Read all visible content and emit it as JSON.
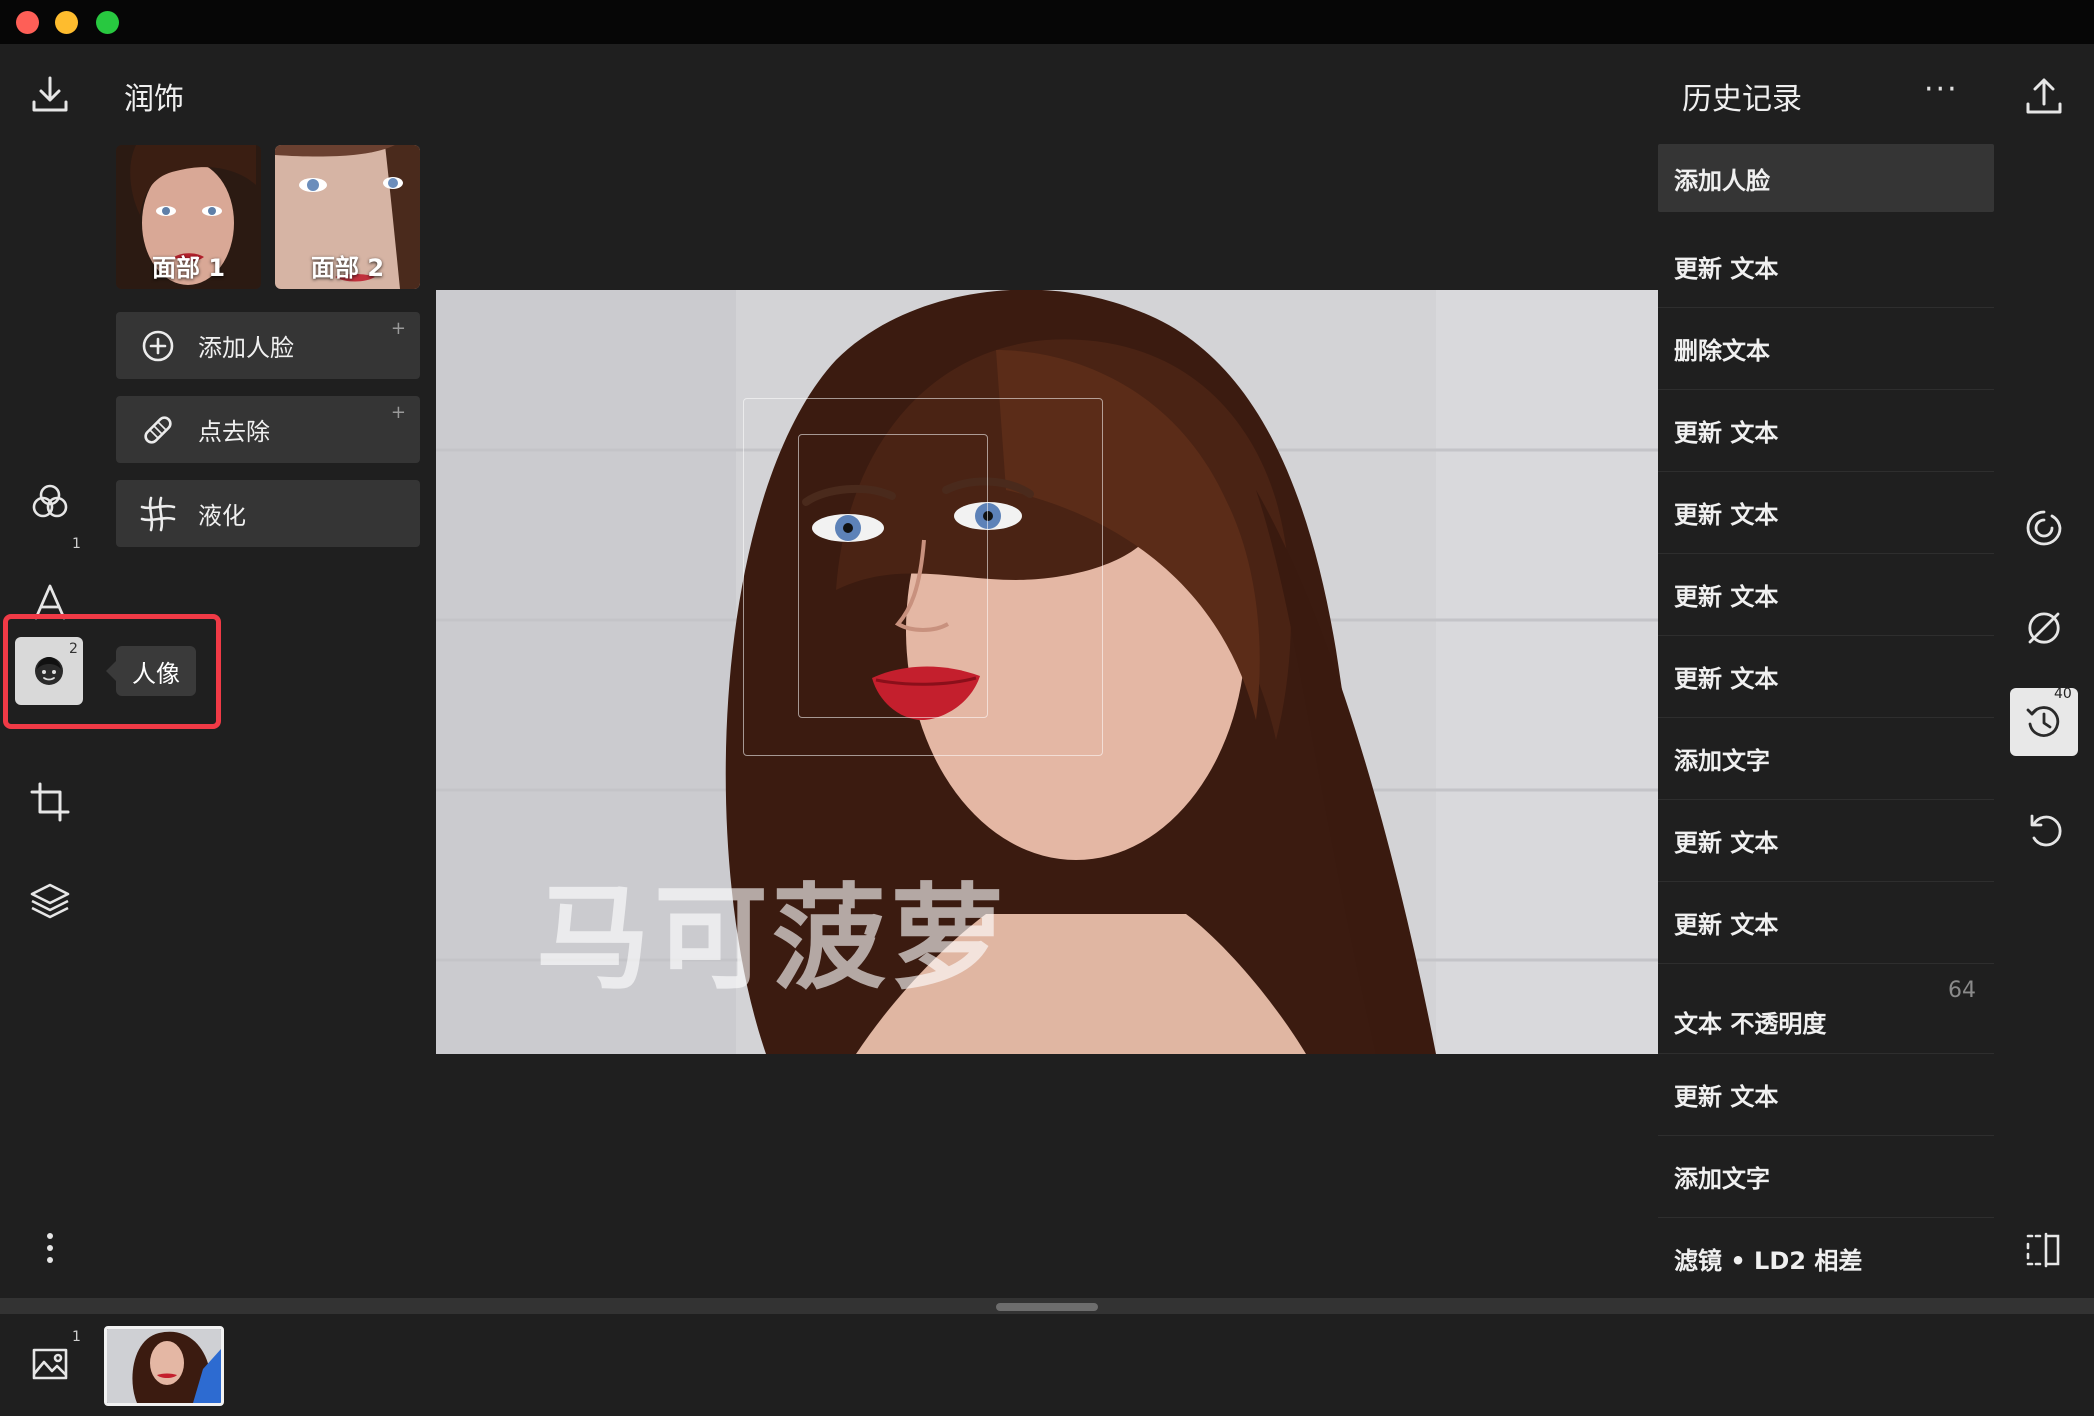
{
  "left_panel": {
    "title": "润饰",
    "text_badge": "1",
    "portrait_badge": "2",
    "faces": [
      {
        "label": "面部 1"
      },
      {
        "label": "面部 2"
      }
    ],
    "tools": [
      {
        "label": "添加人脸",
        "plus": "+",
        "icon": "add-circle-icon"
      },
      {
        "label": "点去除",
        "plus": "+",
        "icon": "bandage-icon"
      },
      {
        "label": "液化",
        "plus": "",
        "icon": "liquify-grid-icon"
      }
    ],
    "tooltip": "人像"
  },
  "canvas": {
    "watermark_text": "马可菠萝"
  },
  "history_panel": {
    "title": "历史记录",
    "more": "···",
    "items": [
      {
        "label": "添加人脸",
        "value": ""
      },
      {
        "label": "更新 文本",
        "value": ""
      },
      {
        "label": "删除文本",
        "value": ""
      },
      {
        "label": "更新 文本",
        "value": ""
      },
      {
        "label": "更新 文本",
        "value": ""
      },
      {
        "label": "更新 文本",
        "value": ""
      },
      {
        "label": "更新 文本",
        "value": ""
      },
      {
        "label": "添加文字",
        "value": ""
      },
      {
        "label": "更新 文本",
        "value": ""
      },
      {
        "label": "更新 文本",
        "value": ""
      },
      {
        "label": "文本 不透明度",
        "value": "64"
      },
      {
        "label": "更新 文本",
        "value": ""
      },
      {
        "label": "添加文字",
        "value": ""
      },
      {
        "label": "滤镜 • LD2 相差",
        "value": ""
      }
    ]
  },
  "right_rail": {
    "history_badge": "40"
  },
  "filmstrip": {
    "gallery_badge": "1"
  },
  "colors": {
    "background": "#1f1f1f",
    "panel_button": "#353535",
    "highlight": "#f03a46"
  }
}
